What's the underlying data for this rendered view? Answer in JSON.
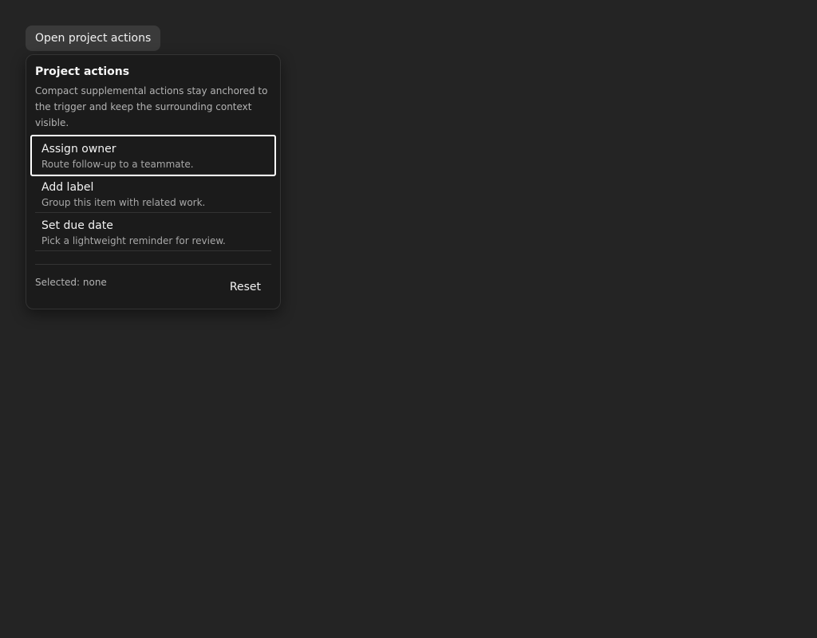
{
  "trigger": {
    "label": "Open project actions"
  },
  "popover": {
    "title": "Project actions",
    "description": "Compact supplemental actions stay anchored to the trigger and keep the surrounding context visible.",
    "items": [
      {
        "label": "Assign owner",
        "description": "Route follow-up to a teammate.",
        "focused": true
      },
      {
        "label": "Add label",
        "description": "Group this item with related work.",
        "focused": false
      },
      {
        "label": "Set due date",
        "description": "Pick a lightweight reminder for review.",
        "focused": false
      }
    ],
    "status": "Selected: none",
    "reset_label": "Reset"
  },
  "colors": {
    "page_background": "#242424",
    "popover_background": "#1b1b1b",
    "trigger_background": "#3a3a3a",
    "focus_ring": "#ffffff"
  }
}
